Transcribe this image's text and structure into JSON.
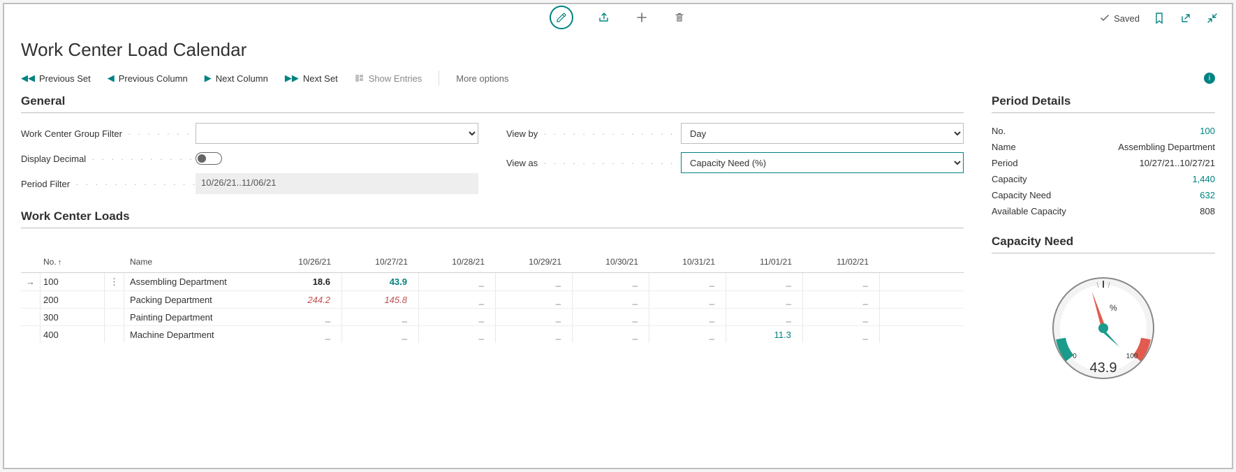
{
  "header": {
    "edit_icon": "pencil",
    "share_icon": "share",
    "add_icon": "plus",
    "delete_icon": "trash",
    "saved_label": "Saved",
    "bookmark_icon": "bookmark",
    "popout_icon": "popout",
    "collapse_icon": "collapse"
  },
  "page": {
    "title": "Work Center Load Calendar"
  },
  "toolbar": {
    "prev_set": "Previous Set",
    "prev_col": "Previous Column",
    "next_col": "Next Column",
    "next_set": "Next Set",
    "show_entries": "Show Entries",
    "more": "More options"
  },
  "general": {
    "heading": "General",
    "work_center_group_filter_label": "Work Center Group Filter",
    "work_center_group_filter_value": "",
    "display_decimal_label": "Display Decimal",
    "display_decimal_on": false,
    "period_filter_label": "Period Filter",
    "period_filter_value": "10/26/21..11/06/21",
    "view_by_label": "View by",
    "view_by_value": "Day",
    "view_as_label": "View as",
    "view_as_value": "Capacity Need (%)"
  },
  "loads": {
    "heading": "Work Center Loads",
    "columns": {
      "no": "No.",
      "name": "Name",
      "dates": [
        "10/26/21",
        "10/27/21",
        "10/28/21",
        "10/29/21",
        "10/30/21",
        "10/31/21",
        "11/01/21",
        "11/02/21"
      ]
    },
    "rows": [
      {
        "no": "100",
        "name": "Assembling Department",
        "values": [
          "18.6",
          "43.9",
          "_",
          "_",
          "_",
          "_",
          "_",
          "_"
        ],
        "style": [
          "bold",
          "teal",
          "dash",
          "dash",
          "dash",
          "dash",
          "dash",
          "dash"
        ],
        "selected": true
      },
      {
        "no": "200",
        "name": "Packing Department",
        "values": [
          "244.2",
          "145.8",
          "_",
          "_",
          "_",
          "_",
          "_",
          "_"
        ],
        "style": [
          "red",
          "red",
          "dash",
          "dash",
          "dash",
          "dash",
          "dash",
          "dash"
        ],
        "selected": false
      },
      {
        "no": "300",
        "name": "Painting Department",
        "values": [
          "_",
          "_",
          "_",
          "_",
          "_",
          "_",
          "_",
          "_"
        ],
        "style": [
          "dash",
          "dash",
          "dash",
          "dash",
          "dash",
          "dash",
          "dash",
          "dash"
        ],
        "selected": false
      },
      {
        "no": "400",
        "name": "Machine Department",
        "values": [
          "_",
          "_",
          "_",
          "_",
          "_",
          "_",
          "11.3",
          "_"
        ],
        "style": [
          "dash",
          "dash",
          "dash",
          "dash",
          "dash",
          "dash",
          "tealnum",
          "dash"
        ],
        "selected": false
      }
    ]
  },
  "period_details": {
    "heading": "Period Details",
    "rows": [
      {
        "label": "No.",
        "value": "100",
        "link": true
      },
      {
        "label": "Name",
        "value": "Assembling Department",
        "link": false
      },
      {
        "label": "Period",
        "value": "10/27/21..10/27/21",
        "link": false
      },
      {
        "label": "Capacity",
        "value": "1,440",
        "link": true
      },
      {
        "label": "Capacity Need",
        "value": "632",
        "link": true
      },
      {
        "label": "Available Capacity",
        "value": "808",
        "link": false
      }
    ]
  },
  "capacity_need": {
    "heading": "Capacity Need",
    "value_display": "43.9",
    "scale_min": "0",
    "scale_max": "100",
    "unit": "%"
  },
  "chart_data": {
    "type": "gauge",
    "title": "Capacity Need",
    "unit": "%",
    "value": 43.9,
    "min": 0,
    "max": 100,
    "ranges": [
      {
        "from": 0,
        "to": 30,
        "color": "#1b9b8a"
      },
      {
        "from": 70,
        "to": 100,
        "color": "#e15b4f"
      }
    ]
  }
}
